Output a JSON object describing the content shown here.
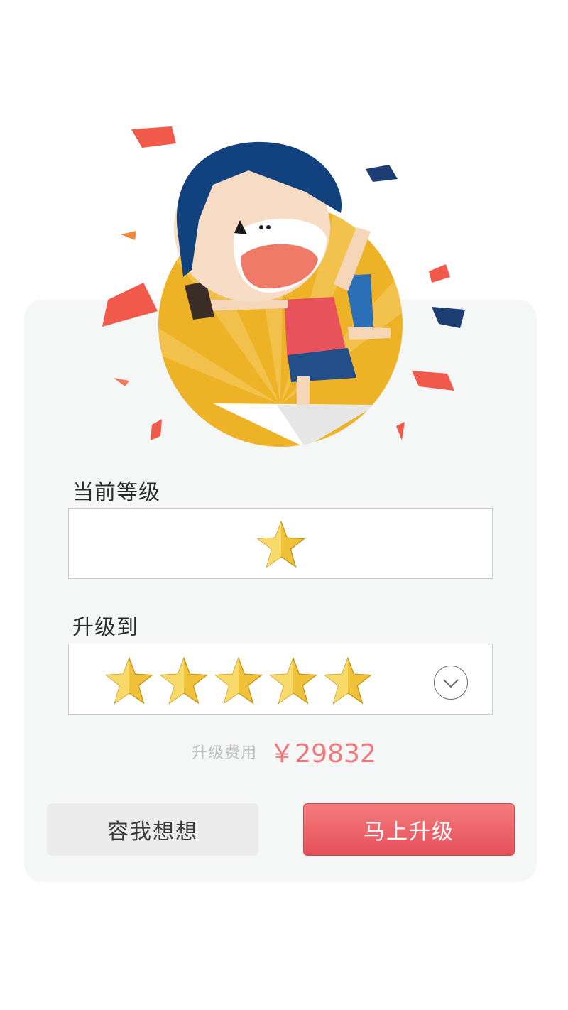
{
  "current_level": {
    "label": "当前等级",
    "stars": 1
  },
  "upgrade_to": {
    "label": "升级到",
    "stars": 5,
    "dropdown_icon": "chevron-down-icon"
  },
  "fee": {
    "label": "升级费用",
    "amount": "￥29832"
  },
  "buttons": {
    "cancel_label": "容我想想",
    "confirm_label": "马上升级"
  },
  "colors": {
    "accent": "#e95a62",
    "star": "#f0c23a",
    "price": "#f2777a"
  }
}
